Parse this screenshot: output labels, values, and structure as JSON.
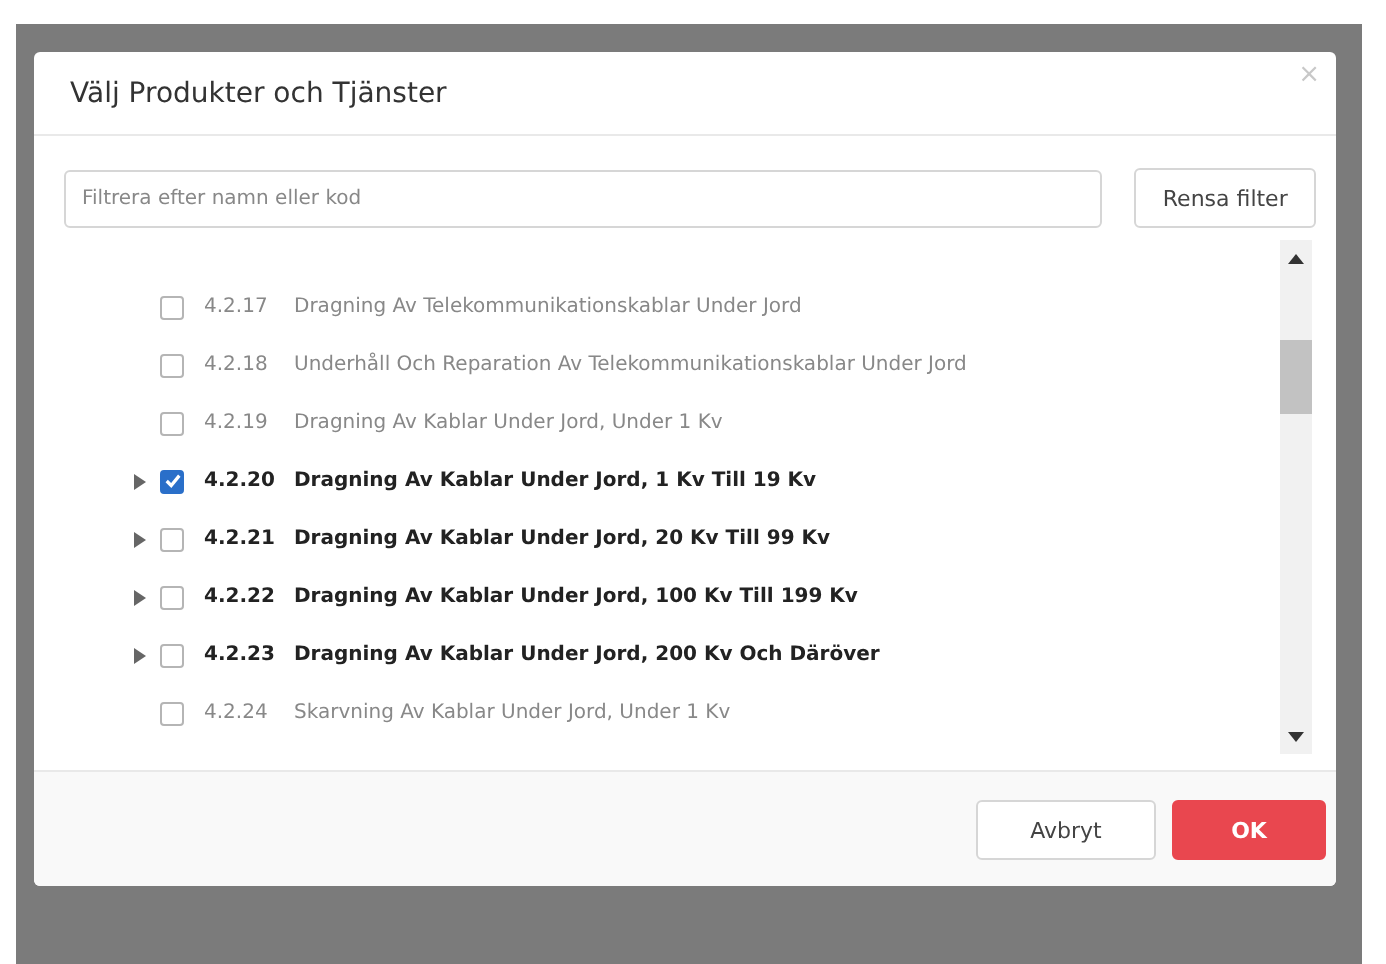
{
  "dialog": {
    "title": "Välj Produkter och Tjänster",
    "close": "×"
  },
  "filter": {
    "placeholder": "Filtrera efter namn eller kod",
    "clear_button": "Rensa filter"
  },
  "rows": [
    {
      "code": "4.2.17",
      "name": "Dragning Av Telekommunikationskablar Under Jord",
      "kind": "leaf",
      "checked": false
    },
    {
      "code": "4.2.18",
      "name": "Underhåll Och Reparation Av Telekommunikationskablar Under Jord",
      "kind": "leaf",
      "checked": false
    },
    {
      "code": "4.2.19",
      "name": "Dragning Av Kablar Under Jord, Under 1 Kv",
      "kind": "leaf",
      "checked": false
    },
    {
      "code": "4.2.20",
      "name": "Dragning Av Kablar Under Jord, 1 Kv Till 19 Kv",
      "kind": "group",
      "checked": true
    },
    {
      "code": "4.2.21",
      "name": "Dragning Av Kablar Under Jord, 20 Kv Till 99 Kv",
      "kind": "group",
      "checked": false
    },
    {
      "code": "4.2.22",
      "name": "Dragning Av Kablar Under Jord, 100 Kv Till 199 Kv",
      "kind": "group",
      "checked": false
    },
    {
      "code": "4.2.23",
      "name": "Dragning Av Kablar Under Jord, 200 Kv Och Däröver",
      "kind": "group",
      "checked": false
    },
    {
      "code": "4.2.24",
      "name": "Skarvning Av Kablar Under Jord, Under 1 Kv",
      "kind": "leaf",
      "checked": false
    }
  ],
  "buttons": {
    "cancel": "Avbryt",
    "ok": "OK"
  }
}
